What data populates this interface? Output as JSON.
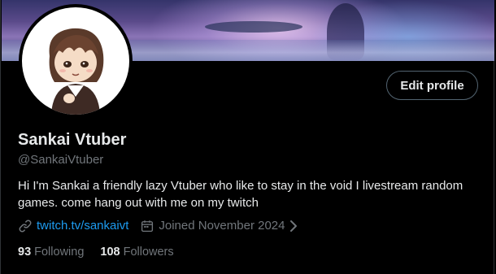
{
  "profile": {
    "display_name": "Sankai Vtuber",
    "handle": "@SankaiVtuber",
    "bio": "Hi I'm Sankai a friendly lazy Vtuber who like to stay in the void I livestream random games. come hang out with me on my twitch",
    "website": "twitch.tv/sankaivt",
    "joined": "Joined November 2024",
    "edit_label": "Edit profile"
  },
  "stats": {
    "following_count": "93",
    "following_label": "Following",
    "followers_count": "108",
    "followers_label": "Followers"
  },
  "icons": {
    "link": "link-icon",
    "calendar": "calendar-icon",
    "chevron": "chevron-right-icon"
  },
  "colors": {
    "background": "#000000",
    "text": "#e7e9ea",
    "muted": "#71767b",
    "link": "#1d9bf0",
    "border": "#536471"
  }
}
